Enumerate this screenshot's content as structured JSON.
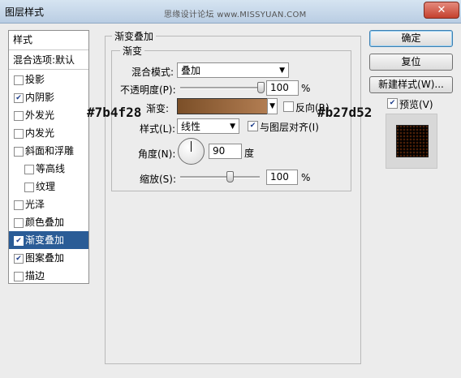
{
  "window": {
    "title": "图层样式",
    "watermark": "思缘设计论坛 www.MISSYUAN.COM",
    "close_label": "✕"
  },
  "sidebar": {
    "header": "样式",
    "blend_options": "混合选项:默认",
    "items": [
      {
        "label": "投影",
        "checked": false,
        "selected": false,
        "sub": false
      },
      {
        "label": "内阴影",
        "checked": true,
        "selected": false,
        "sub": false
      },
      {
        "label": "外发光",
        "checked": false,
        "selected": false,
        "sub": false
      },
      {
        "label": "内发光",
        "checked": false,
        "selected": false,
        "sub": false
      },
      {
        "label": "斜面和浮雕",
        "checked": false,
        "selected": false,
        "sub": false
      },
      {
        "label": "等高线",
        "checked": false,
        "selected": false,
        "sub": true
      },
      {
        "label": "纹理",
        "checked": false,
        "selected": false,
        "sub": true
      },
      {
        "label": "光泽",
        "checked": false,
        "selected": false,
        "sub": false
      },
      {
        "label": "颜色叠加",
        "checked": false,
        "selected": false,
        "sub": false
      },
      {
        "label": "渐变叠加",
        "checked": true,
        "selected": true,
        "sub": false
      },
      {
        "label": "图案叠加",
        "checked": true,
        "selected": false,
        "sub": false
      },
      {
        "label": "描边",
        "checked": false,
        "selected": false,
        "sub": false
      }
    ]
  },
  "panel": {
    "group_title": "渐变叠加",
    "subgroup_title": "渐变",
    "blend_mode_label": "混合模式:",
    "blend_mode_value": "叠加",
    "opacity_label": "不透明度(P):",
    "opacity_value": "100",
    "opacity_unit": "%",
    "opacity_fraction": 1.0,
    "gradient_label": "渐变:",
    "gradient_start": "#7b4f28",
    "gradient_end": "#b27d52",
    "reverse_label": "反向(R)",
    "reverse_checked": false,
    "style_label": "样式(L):",
    "style_value": "线性",
    "align_label": "与图层对齐(I)",
    "align_checked": true,
    "angle_label": "角度(N):",
    "angle_value": "90",
    "angle_unit": "度",
    "scale_label": "缩放(S):",
    "scale_value": "100",
    "scale_unit": "%",
    "scale_fraction": 0.62
  },
  "callouts": {
    "left": "#7b4f28",
    "right": "#b27d52"
  },
  "buttons": {
    "ok": "确定",
    "reset": "复位",
    "new_style": "新建样式(W)...",
    "preview_label": "预览(V)",
    "preview_checked": true
  },
  "colors": {
    "selection": "#2a5c96",
    "gradient_start": "#7b4f28",
    "gradient_end": "#b27d52"
  }
}
